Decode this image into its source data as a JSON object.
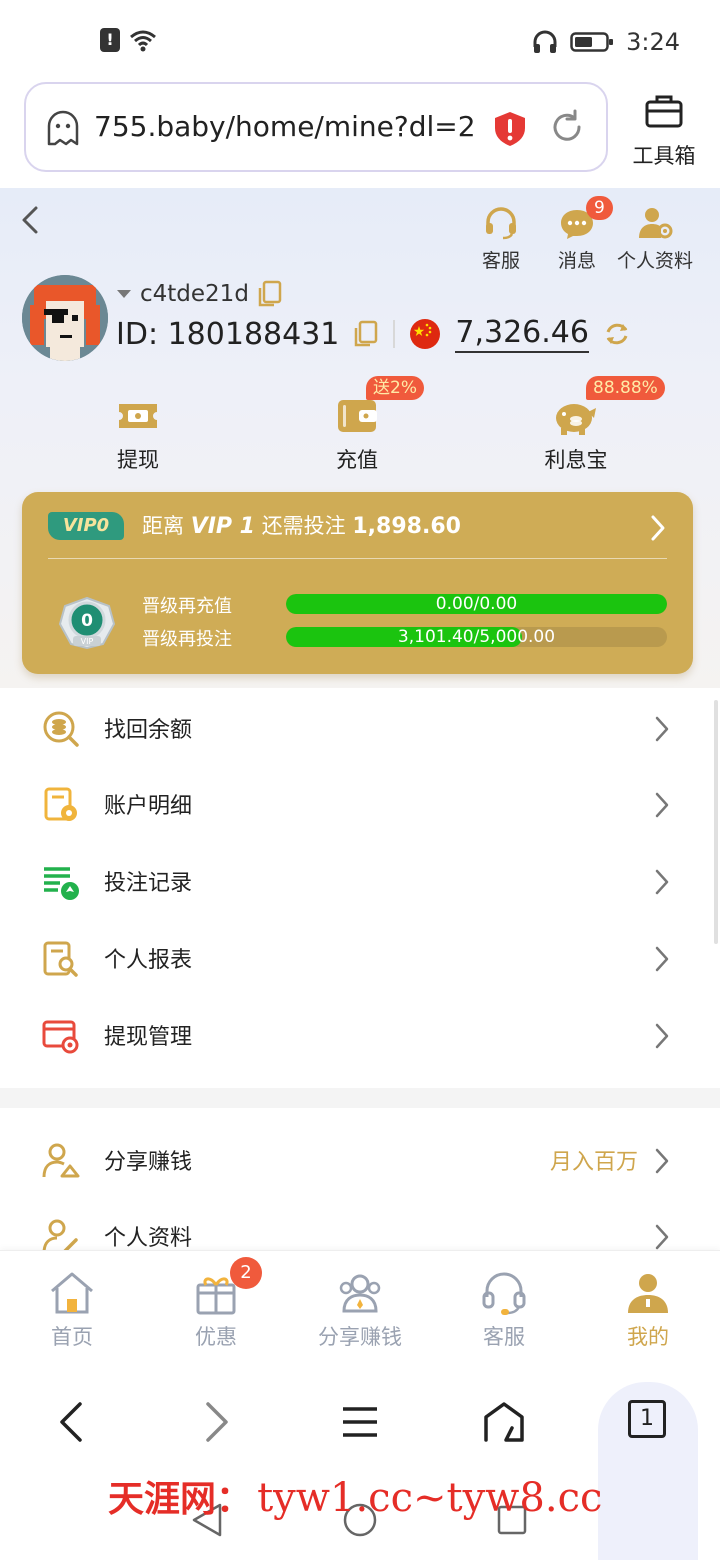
{
  "status_bar": {
    "time": "3:24"
  },
  "browser": {
    "url": "755.baby/home/mine?dl=2…",
    "toolbox_label": "工具箱"
  },
  "header": {
    "actions": [
      {
        "label": "客服"
      },
      {
        "label": "消息",
        "badge": "9"
      },
      {
        "label": "个人资料"
      }
    ],
    "username": "c4tde21d",
    "id_text": "ID: 180188431",
    "balance": "7,326.46"
  },
  "quick_actions": [
    {
      "label": "提现"
    },
    {
      "label": "充值",
      "badge": "送2%"
    },
    {
      "label": "利息宝",
      "badge": "88.88%"
    }
  ],
  "vip": {
    "tag": "VIP0",
    "prefix": "距离",
    "level": "VIP 1",
    "middle": "还需投注",
    "remaining": "1,898.60",
    "medal_level": "0",
    "medal_caption": "VIP",
    "progress": [
      {
        "label": "晋级再充值",
        "text": "0.00/0.00",
        "fraction": 1.0
      },
      {
        "label": "晋级再投注",
        "text": "3,101.40/5,000.00",
        "fraction": 0.62
      }
    ]
  },
  "menu": [
    {
      "label": "找回余额"
    },
    {
      "label": "账户明细"
    },
    {
      "label": "投注记录"
    },
    {
      "label": "个人报表"
    },
    {
      "label": "提现管理"
    }
  ],
  "menu2": [
    {
      "label": "分享赚钱",
      "extra": "月入百万"
    },
    {
      "label": "个人资料"
    }
  ],
  "bottom_nav": [
    {
      "label": "首页"
    },
    {
      "label": "优惠",
      "badge": "2"
    },
    {
      "label": "分享赚钱"
    },
    {
      "label": "客服"
    },
    {
      "label": "我的",
      "active": true
    }
  ],
  "browser_toolbar": {
    "tab_count": "1"
  },
  "watermark": {
    "cn": "天涯网：",
    "url": "tyw1.cc~tyw8.cc"
  },
  "colors": {
    "gold": "#cfac56",
    "accent_text": "#cfa64d",
    "badge": "#f05a3c",
    "progress_green": "#1bc40f",
    "vip_tag": "#2f9a7e"
  }
}
